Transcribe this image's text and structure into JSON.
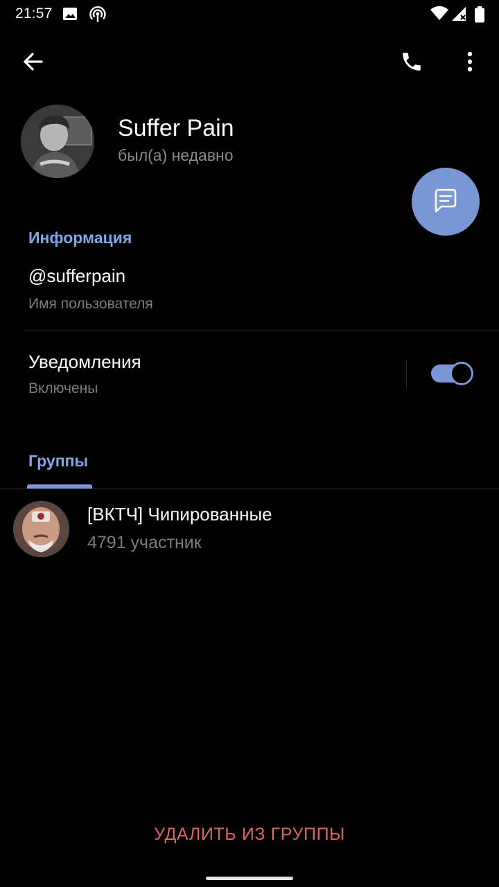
{
  "status_bar": {
    "time": "21:57",
    "icons": [
      "image-icon",
      "hotspot-icon",
      "wifi-icon",
      "signal-icon",
      "battery-icon"
    ]
  },
  "app_bar": {
    "back_icon": "arrow-back-icon",
    "call_icon": "phone-icon",
    "menu_icon": "more-vert-icon"
  },
  "profile": {
    "name": "Suffer Pain",
    "status": "был(а) недавно"
  },
  "info": {
    "section_title": "Информация",
    "username": "@sufferpain",
    "username_caption": "Имя пользователя",
    "notifications_title": "Уведомления",
    "notifications_caption": "Включены",
    "notifications_enabled": true
  },
  "groups": {
    "tab_title": "Группы",
    "items": [
      {
        "name": "[ВКТЧ] Чипированные",
        "members": "4791 участник"
      }
    ]
  },
  "actions": {
    "remove_label": "УДАЛИТЬ ИЗ ГРУППЫ"
  },
  "colors": {
    "accent": "#7a96d4",
    "section_title": "#7fa7e8",
    "danger": "#d9675f",
    "background": "#000000"
  }
}
